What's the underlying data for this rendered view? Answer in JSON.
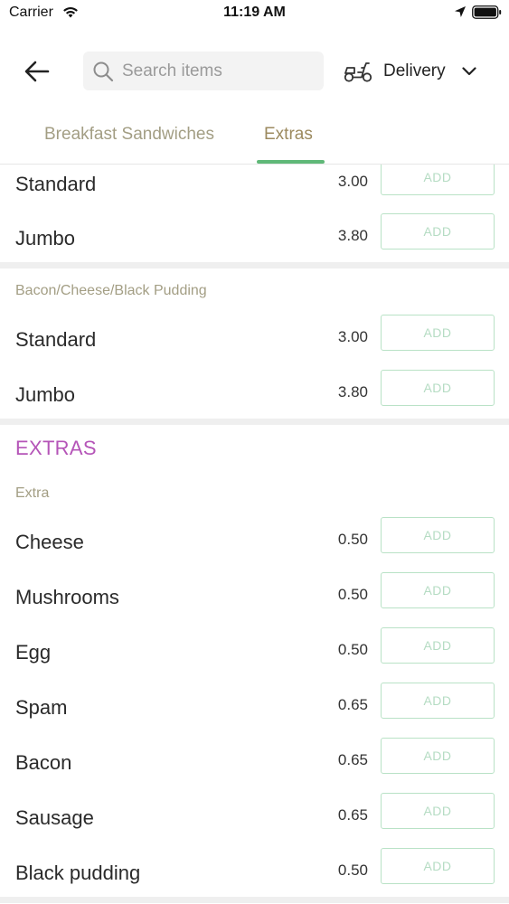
{
  "status_bar": {
    "carrier": "Carrier",
    "time": "11:19 AM"
  },
  "header": {
    "search_placeholder": "Search items",
    "delivery_label": "Delivery",
    "icons": [
      "back-arrow-icon",
      "search-icon",
      "scooter-icon",
      "chevron-down-icon"
    ]
  },
  "tabs": [
    {
      "label": "Breakfast Sandwiches",
      "active": false
    },
    {
      "label": "Extras",
      "active": true
    }
  ],
  "colors": {
    "accent_green": "#5fb878",
    "section_title": "#b555b8",
    "muted_label": "#a39e84"
  },
  "groups": [
    {
      "label": "",
      "items": [
        {
          "name": "Standard",
          "price": "3.00",
          "button": "ADD"
        },
        {
          "name": "Jumbo",
          "price": "3.80",
          "button": "ADD"
        }
      ]
    },
    {
      "label": "Bacon/Cheese/Black Pudding",
      "items": [
        {
          "name": "Standard",
          "price": "3.00",
          "button": "ADD"
        },
        {
          "name": "Jumbo",
          "price": "3.80",
          "button": "ADD"
        }
      ]
    }
  ],
  "extras_section": {
    "title": "EXTRAS",
    "group_label": "Extra",
    "items": [
      {
        "name": "Cheese",
        "price": "0.50",
        "button": "ADD"
      },
      {
        "name": "Mushrooms",
        "price": "0.50",
        "button": "ADD"
      },
      {
        "name": "Egg",
        "price": "0.50",
        "button": "ADD"
      },
      {
        "name": "Spam",
        "price": "0.65",
        "button": "ADD"
      },
      {
        "name": "Bacon",
        "price": "0.65",
        "button": "ADD"
      },
      {
        "name": "Sausage",
        "price": "0.65",
        "button": "ADD"
      },
      {
        "name": "Black pudding",
        "price": "0.50",
        "button": "ADD"
      }
    ]
  }
}
